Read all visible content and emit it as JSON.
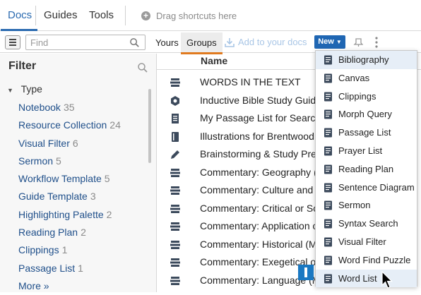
{
  "tabs": [
    {
      "label": "Docs",
      "active": true
    },
    {
      "label": "Guides",
      "active": false
    },
    {
      "label": "Tools",
      "active": false
    }
  ],
  "shortcut_hint": "Drag shortcuts here",
  "toolbar": {
    "find_placeholder": "Find",
    "yours": "Yours",
    "groups": "Groups",
    "add_to_docs": "Add to your docs",
    "new_button": "New"
  },
  "filter": {
    "title": "Filter",
    "type_heading": "Type",
    "items": [
      {
        "label": "Notebook",
        "count": "35"
      },
      {
        "label": "Resource Collection",
        "count": "24"
      },
      {
        "label": "Visual Filter",
        "count": "6"
      },
      {
        "label": "Sermon",
        "count": "5"
      },
      {
        "label": "Workflow Template",
        "count": "5"
      },
      {
        "label": "Guide Template",
        "count": "3"
      },
      {
        "label": "Highlighting Palette",
        "count": "2"
      },
      {
        "label": "Reading Plan",
        "count": "2"
      },
      {
        "label": "Clippings",
        "count": "1"
      },
      {
        "label": "Passage List",
        "count": "1"
      },
      {
        "label": "More »",
        "count": ""
      }
    ]
  },
  "main": {
    "column_name": "Name",
    "rows": [
      {
        "title": "WORDS IN THE TEXT",
        "icon": "stack-icon"
      },
      {
        "title": "Inductive Bible Study Guide",
        "icon": "hexagon-icon"
      },
      {
        "title": "My Passage List for Searching",
        "icon": "bookmark-list-icon"
      },
      {
        "title": "Illustrations for Brentwood",
        "icon": "notebook-icon"
      },
      {
        "title": "Brainstorming & Study Prep",
        "icon": "pencil-icon"
      },
      {
        "title": "Commentary: Geography (M",
        "icon": "stack-icon"
      },
      {
        "title": "Commentary: Culture and H",
        "icon": "stack-icon"
      },
      {
        "title": "Commentary: Critical or Sch",
        "icon": "stack-icon"
      },
      {
        "title": "Commentary: Application o",
        "icon": "stack-icon"
      },
      {
        "title": "Commentary: Historical (MF",
        "icon": "stack-icon"
      },
      {
        "title": "Commentary: Exegetical or",
        "icon": "stack-icon"
      },
      {
        "title": "Commentary: Language (M",
        "icon": "stack-icon"
      }
    ]
  },
  "new_menu": {
    "items": [
      {
        "label": "Bibliography",
        "highlighted": true
      },
      {
        "label": "Canvas",
        "highlighted": false
      },
      {
        "label": "Clippings",
        "highlighted": false
      },
      {
        "label": "Morph Query",
        "highlighted": false
      },
      {
        "label": "Passage List",
        "highlighted": false
      },
      {
        "label": "Prayer List",
        "highlighted": false
      },
      {
        "label": "Reading Plan",
        "highlighted": false
      },
      {
        "label": "Sentence Diagram",
        "highlighted": false
      },
      {
        "label": "Sermon",
        "highlighted": false
      },
      {
        "label": "Syntax Search",
        "highlighted": false
      },
      {
        "label": "Visual Filter",
        "highlighted": false
      },
      {
        "label": "Word Find Puzzle",
        "highlighted": false
      },
      {
        "label": "Word List",
        "highlighted": true
      }
    ]
  },
  "colors": {
    "accent": "#2a6ab0",
    "new_button": "#1f66b3",
    "groups_underline": "#e07a1f",
    "link": "#1f4f8a"
  }
}
